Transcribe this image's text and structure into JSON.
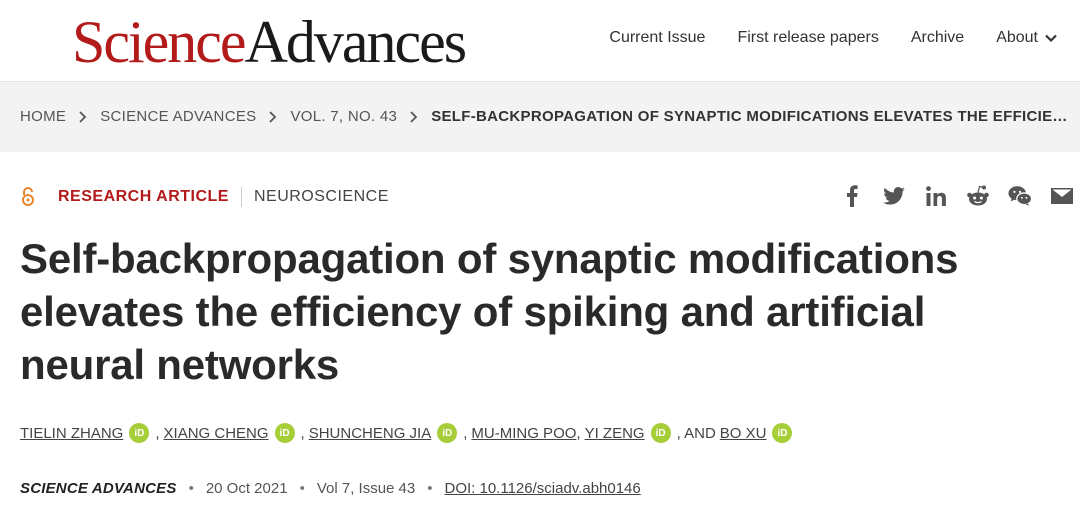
{
  "brand": {
    "part1": "Science",
    "part2": "Advances"
  },
  "nav": {
    "items": [
      "Current Issue",
      "First release papers",
      "Archive"
    ],
    "about": "About"
  },
  "breadcrumb": {
    "items": [
      "HOME",
      "SCIENCE ADVANCES",
      "VOL. 7, NO. 43",
      "SELF-BACKPROPAGATION OF SYNAPTIC MODIFICATIONS ELEVATES THE EFFICIENCY OF SPIKING AND ARTIFICIAL NEURAL NETWORKS"
    ]
  },
  "article": {
    "type": "RESEARCH ARTICLE",
    "subject": "NEUROSCIENCE",
    "title": "Self-backpropagation of synaptic modifications ele­vates the efficiency of spiking and artificial neural networks",
    "authors": [
      "TIELIN ZHANG",
      "XIANG CHENG",
      "SHUNCHENG JIA",
      "MU-MING POO",
      "YI ZENG",
      "BO XU"
    ],
    "author_separators": [
      ",",
      ",",
      ",",
      ",",
      ", AND"
    ],
    "orcid_label": "iD",
    "journal": "Science Advances",
    "date": "20 Oct 2021",
    "volume": "Vol 7, Issue 43",
    "doi": "DOI: 10.1126/sciadv.abh0146"
  },
  "share_icons": [
    "facebook-icon",
    "twitter-icon",
    "linkedin-icon",
    "reddit-icon",
    "wechat-icon",
    "email-icon"
  ],
  "colors": {
    "brand_red": "#b31b1b",
    "orcid_green": "#a6ce39",
    "crumb_bg": "#f3f3f3"
  }
}
